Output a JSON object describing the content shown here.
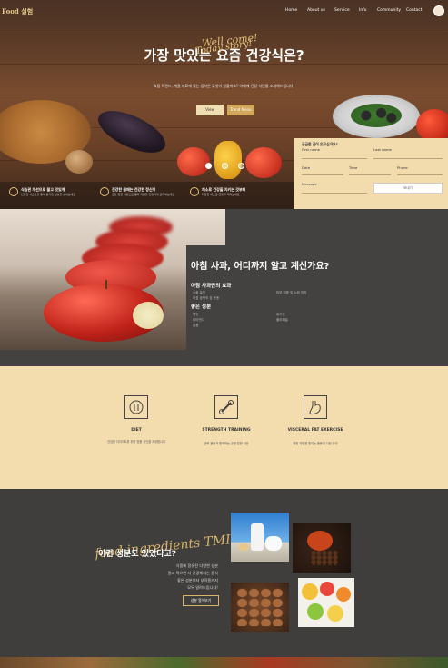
{
  "header": {
    "logo": "Food 실험",
    "nav": [
      "Home",
      "About us",
      "Service",
      "Info",
      "Community",
      "Contact"
    ]
  },
  "hero": {
    "script": "Well come!",
    "title": "가장 맛있는 요즘 건강식은?",
    "subtitle": "요즘 트렌드, 계절 재료에 맞는 음식은 무엇이 있을까요? 아래에 건강 식단을 소개해드립니다!",
    "btn_view": "View",
    "btn_trend": "Trend Menu"
  },
  "features": [
    {
      "title": "식습관 개선으로 젊고 멋있게",
      "desc": "건강한 식습관을 통해 활기찬 일상을 보내보세요"
    },
    {
      "title": "건강한 몸매는 건강한 정신이",
      "desc": "균형 잡힌 식단으로 몸과 마음을 건강하게 관리해보세요"
    },
    {
      "title": "채소로 건강을 지키는 것부터",
      "desc": "다양한 채소로 건강을 지켜보세요"
    }
  ],
  "form": {
    "title": "궁금한 것이 있으신가요?",
    "first_name": "First name",
    "last_name": "Last name",
    "date": "Date",
    "time": "Time",
    "phone": "Phone",
    "message": "Message",
    "send": "보내기"
  },
  "apple": {
    "script": "Today story!",
    "title": "아침 사과, 어디까지 알고 계신가요?",
    "effect_heading": "아침 사과만의 효과",
    "effects_left": [
      "소화 촉진",
      "아침 공복의 장 운동"
    ],
    "effects_right": [
      "피부 미용 및 노화 방지"
    ],
    "good_heading": "좋은 성분",
    "good_left": [
      "펙틴",
      "비타민C",
      "칼륨"
    ],
    "good_right": [
      "유기산",
      "폴리페놀"
    ]
  },
  "services": [
    {
      "title": "DIET",
      "desc": "건강한 다이어트를 위한 맞춤 식단을 제공합니다"
    },
    {
      "title": "STRENGTH TRAINING",
      "desc": "근력 운동과 함께하는 균형 잡힌 식단"
    },
    {
      "title": "VISCERAL FAT EXERCISE",
      "desc": "내장 지방을 줄이는 운동과 식단 관리"
    }
  ],
  "ingredients": {
    "script": "food ingredients TMI",
    "title": "이런 성분도 있었다고?",
    "lines": [
      "식품에 함유된 다양한 성분",
      "알고 먹으면 더 건강해지는 음식",
      "좋은 성분부터 부작용까지",
      "모두 알려드립니다!"
    ],
    "button": "성분 알아보기"
  }
}
